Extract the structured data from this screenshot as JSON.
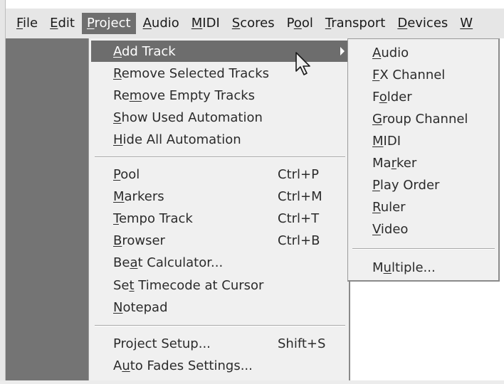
{
  "menubar": {
    "items": [
      {
        "label": "File",
        "u": "F",
        "rest": "ile"
      },
      {
        "label": "Edit",
        "u": "E",
        "rest": "dit"
      },
      {
        "label": "Project",
        "u": "P",
        "rest": "roject"
      },
      {
        "label": "Audio",
        "u": "A",
        "rest": "udio"
      },
      {
        "label": "MIDI",
        "u": "M",
        "rest": "IDI"
      },
      {
        "label": "Scores",
        "u": "S",
        "rest": "cores"
      },
      {
        "label": "Pool",
        "pre": "P",
        "u": "o",
        "rest": "ol"
      },
      {
        "label": "Transport",
        "u": "T",
        "rest": "ransport"
      },
      {
        "label": "Devices",
        "u": "D",
        "rest": "evices"
      },
      {
        "label": "W",
        "u": "W",
        "rest": ""
      }
    ],
    "active": "Project"
  },
  "project_menu": {
    "add_track": {
      "label": "Add Track",
      "pre": "",
      "u": "A",
      "rest": "dd Track"
    },
    "remove_selected": {
      "pre": "",
      "u": "R",
      "rest": "emove Selected Tracks"
    },
    "remove_empty": {
      "pre": "Re",
      "u": "m",
      "rest": "ove Empty Tracks"
    },
    "show_used": {
      "pre": "",
      "u": "S",
      "rest": "how Used Automation"
    },
    "hide_all": {
      "pre": "",
      "u": "H",
      "rest": "ide All Automation"
    },
    "pool": {
      "pre": "",
      "u": "P",
      "rest": "ool",
      "shortcut": "Ctrl+P"
    },
    "markers": {
      "pre": "",
      "u": "M",
      "rest": "arkers",
      "shortcut": "Ctrl+M"
    },
    "tempo": {
      "pre": "",
      "u": "T",
      "rest": "empo Track",
      "shortcut": "Ctrl+T"
    },
    "browser": {
      "pre": "",
      "u": "B",
      "rest": "rowser",
      "shortcut": "Ctrl+B"
    },
    "beat": {
      "pre": "Be",
      "u": "a",
      "rest": "t Calculator...",
      "shortcut": ""
    },
    "timecode": {
      "pre": "Se",
      "u": "t",
      "rest": " Timecode at Cursor",
      "shortcut": ""
    },
    "notepad": {
      "pre": "",
      "u": "N",
      "rest": "otepad",
      "shortcut": ""
    },
    "setup": {
      "pre": "Pro",
      "u": "j",
      "rest": "ect Setup...",
      "shortcut": "Shift+S"
    },
    "autofades": {
      "pre": "A",
      "u": "u",
      "rest": "to Fades Settings...",
      "shortcut": ""
    }
  },
  "submenu": {
    "audio": {
      "pre": "",
      "u": "A",
      "rest": "udio"
    },
    "fx": {
      "pre": "",
      "u": "F",
      "rest": "X Channel"
    },
    "folder": {
      "pre": "F",
      "u": "o",
      "rest": "lder"
    },
    "group": {
      "pre": "",
      "u": "G",
      "rest": "roup Channel"
    },
    "midi": {
      "pre": "",
      "u": "M",
      "rest": "IDI"
    },
    "marker": {
      "pre": "Ma",
      "u": "r",
      "rest": "ker"
    },
    "playorder": {
      "pre": "",
      "u": "P",
      "rest": "lay Order"
    },
    "ruler": {
      "pre": "",
      "u": "R",
      "rest": "uler"
    },
    "video": {
      "pre": "",
      "u": "V",
      "rest": "ideo"
    },
    "multiple": {
      "pre": "M",
      "u": "u",
      "rest": "ltiple..."
    }
  }
}
